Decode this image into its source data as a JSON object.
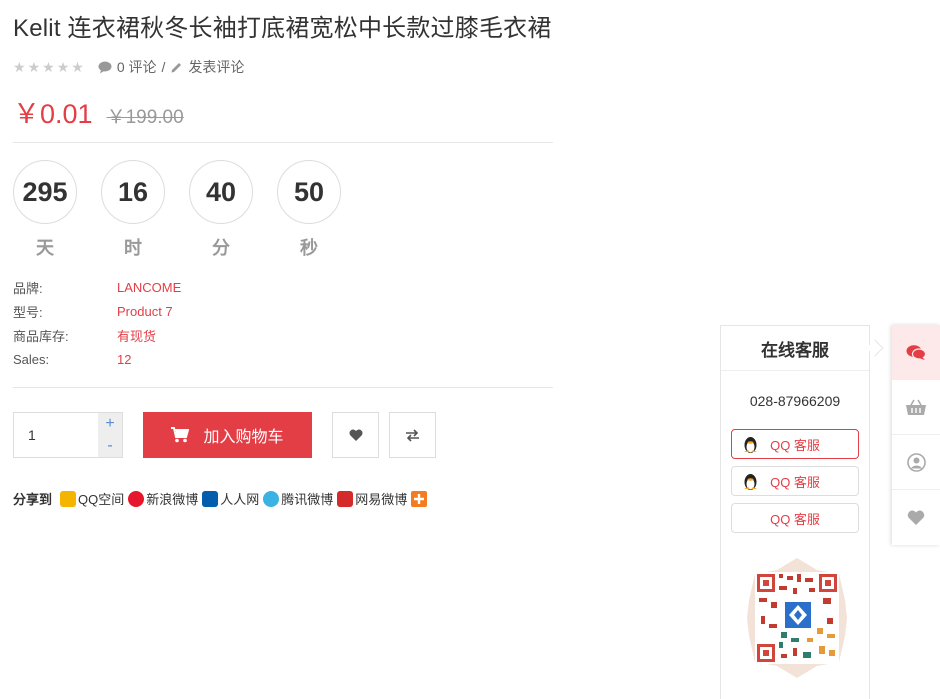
{
  "product": {
    "title": "Kelit 连衣裙秋冬长袖打底裙宽松中长款过膝毛衣裙",
    "stars": [
      "★",
      "★",
      "★",
      "★",
      "★"
    ],
    "review_count": "0 评论",
    "separator": "/",
    "write_review": "发表评论",
    "price": "￥0.01",
    "old_price": "￥199.00"
  },
  "countdown": [
    {
      "value": "295",
      "unit": "天"
    },
    {
      "value": "16",
      "unit": "时"
    },
    {
      "value": "40",
      "unit": "分"
    },
    {
      "value": "50",
      "unit": "秒"
    }
  ],
  "specs": [
    {
      "key": "品牌:",
      "value": "LANCOME"
    },
    {
      "key": "型号:",
      "value": "Product 7"
    },
    {
      "key": "商品库存:",
      "value": "有现货"
    },
    {
      "key": "Sales:",
      "value": "12"
    }
  ],
  "purchase": {
    "quantity": "1",
    "plus": "+",
    "minus": "-",
    "add_to_cart": "加入购物车"
  },
  "share": {
    "label": "分享到",
    "items": [
      {
        "name": "QQ空间",
        "color": "#f5b400"
      },
      {
        "name": "新浪微博",
        "color": "#e6162d"
      },
      {
        "name": "人人网",
        "color": "#005eac"
      },
      {
        "name": "腾讯微博",
        "color": "#3ab2e4"
      },
      {
        "name": "网易微博",
        "color": "#d52a2a"
      }
    ],
    "more_color": "#f47b20"
  },
  "service": {
    "title": "在线客服",
    "phone": "028-87966209",
    "buttons": [
      "QQ 客服",
      "QQ 客服",
      "QQ 客服"
    ]
  },
  "colors": {
    "accent": "#e33e46"
  },
  "icons": {
    "chat": "comment-icon",
    "cart": "basket-icon",
    "user": "user-icon",
    "wishlist": "heart-icon"
  }
}
